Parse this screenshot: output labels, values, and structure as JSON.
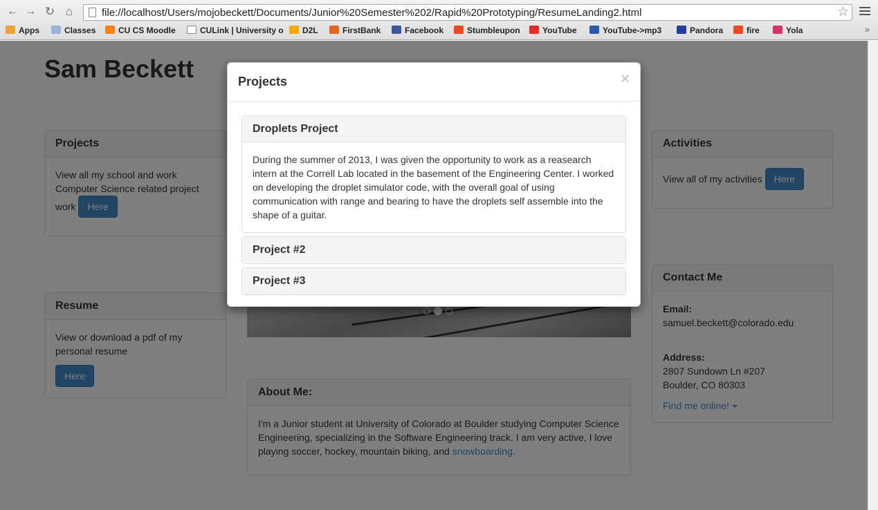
{
  "browser": {
    "url": "file://localhost/Users/mojobeckett/Documents/Junior%20Semester%202/Rapid%20Prototyping/ResumeLanding2.html",
    "bookmarks": [
      {
        "label": "Apps",
        "icon": "apps-grid-icon",
        "color": "#e8a33a"
      },
      {
        "label": "Classes",
        "icon": "folder-icon",
        "color": "#9bb3d6"
      },
      {
        "label": "CU CS Moodle",
        "icon": "moodle-icon",
        "color": "#f98012"
      },
      {
        "label": "CULink | University o",
        "icon": "page-icon",
        "color": "#ffffff"
      },
      {
        "label": "D2L",
        "icon": "d2l-icon",
        "color": "#f2a900"
      },
      {
        "label": "FirstBank",
        "icon": "firstbank-icon",
        "color": "#e2661f"
      },
      {
        "label": "Facebook",
        "icon": "facebook-icon",
        "color": "#3b5998"
      },
      {
        "label": "Stumbleupon",
        "icon": "stumbleupon-icon",
        "color": "#eb4924"
      },
      {
        "label": "YouTube",
        "icon": "youtube-icon",
        "color": "#e52d27"
      },
      {
        "label": "YouTube->mp3",
        "icon": "youtube-mp3-icon",
        "color": "#2b5aa8"
      },
      {
        "label": "Pandora",
        "icon": "pandora-icon",
        "color": "#224099"
      },
      {
        "label": "fire",
        "icon": "stumbleupon-icon",
        "color": "#eb4924"
      },
      {
        "label": "Yola",
        "icon": "yola-icon",
        "color": "#d6336c"
      }
    ]
  },
  "site": {
    "title": "Sam Beckett"
  },
  "projects_panel": {
    "heading": "Projects",
    "text": "View all my school and work Computer Science related project work",
    "button": "Here"
  },
  "resume_panel": {
    "heading": "Resume",
    "text": "View or download a pdf of my personal resume",
    "button": "Here"
  },
  "activities_panel": {
    "heading": "Activities",
    "text": "View all of my activities",
    "button": "Here"
  },
  "contact_panel": {
    "heading": "Contact Me",
    "email_label": "Email:",
    "email": "samuel.beckett@colorado.edu",
    "address_label": "Address:",
    "address_line1": "2807 Sundown Ln #207",
    "address_line2": "Boulder, CO 80303",
    "online_link": "Find me online!"
  },
  "about_panel": {
    "heading": "About Me:",
    "text": "I'm a Junior student at University of Colorado at Boulder studying Computer Science Engineering, specializing in the Software Engineering track. I am very active, I love playing soccer, hockey, mountain biking, and ",
    "link": "snowboarding",
    "tail": "."
  },
  "carousel": {
    "slide_count": 3,
    "active_index": 1
  },
  "modal": {
    "title": "Projects",
    "close": "×",
    "items": [
      {
        "title": "Droplets Project",
        "body": "During the summer of 2013, I was given the opportunity to work as a reasearch intern at the Correll Lab located in the basement of the Engineering Center. I worked on developing the droplet simulator code, with the overall goal of using communication with range and bearing to have the droplets self assemble into the shape of a guitar."
      },
      {
        "title": "Project #2"
      },
      {
        "title": "Project #3"
      }
    ]
  }
}
